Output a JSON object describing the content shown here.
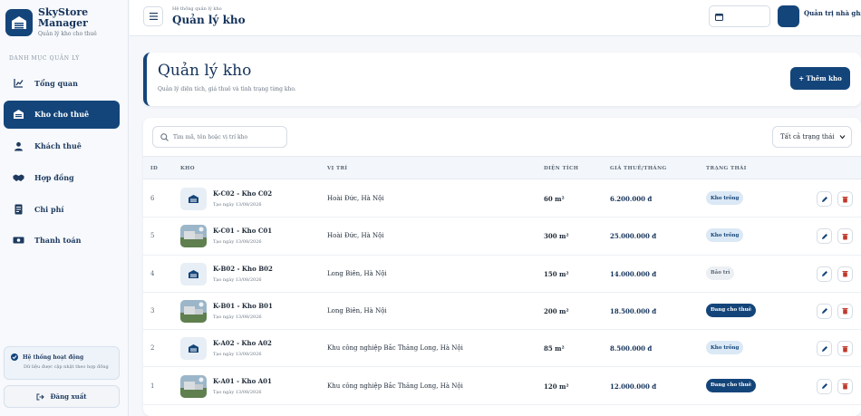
{
  "brand": {
    "name": "SkyStore Manager",
    "subtitle": "Quản lý kho cho thuê"
  },
  "sidebar": {
    "section_label": "DANH MỤC QUẢN LÝ",
    "items": [
      {
        "label": "Tổng quan",
        "icon": "chart-icon"
      },
      {
        "label": "Kho cho thuê",
        "icon": "warehouse-icon",
        "active": true
      },
      {
        "label": "Khách thuê",
        "icon": "user-icon"
      },
      {
        "label": "Hợp đồng",
        "icon": "handshake-icon"
      },
      {
        "label": "Chi phí",
        "icon": "receipt-icon"
      },
      {
        "label": "Thanh toán",
        "icon": "money-icon"
      }
    ],
    "status": {
      "title": "Hệ thống hoạt động",
      "desc": "Dữ liệu được cập nhật theo hợp đồng"
    },
    "logout_label": "Đăng xuất"
  },
  "header": {
    "breadcrumb": "Hệ thống quản lý kho",
    "title": "Quản lý kho",
    "user_name": "Quản trị nhà ghi"
  },
  "page": {
    "title": "Quản lý kho",
    "description": "Quản lý diện tích, giá thuê và tình trạng từng kho.",
    "add_button": "+ Thêm kho"
  },
  "table": {
    "search_placeholder": "Tìm mã, tên hoặc vị trí kho",
    "filter_value": "Tất cả trạng thái",
    "columns": [
      "ID",
      "KHO",
      "VỊ TRÍ",
      "DIỆN TÍCH",
      "GIÁ THUÊ/THÁNG",
      "TRẠNG THÁI"
    ],
    "rows": [
      {
        "id": "6",
        "name": "K-C02 - Kho C02",
        "date": "Tạo ngày 13/08/2026",
        "location": "Hoài Đức, Hà Nội",
        "area": "60 m²",
        "price": "6.200.000 đ",
        "status": "Kho trống",
        "status_type": "empty",
        "thumb": "icon"
      },
      {
        "id": "5",
        "name": "K-C01 - Kho C01",
        "date": "Tạo ngày 13/08/2026",
        "location": "Hoài Đức, Hà Nội",
        "area": "300 m²",
        "price": "25.000.000 đ",
        "status": "Kho trống",
        "status_type": "empty",
        "thumb": "photo"
      },
      {
        "id": "4",
        "name": "K-B02 - Kho B02",
        "date": "Tạo ngày 13/08/2026",
        "location": "Long Biên, Hà Nội",
        "area": "150 m²",
        "price": "14.000.000 đ",
        "status": "Bảo trì",
        "status_type": "maint",
        "thumb": "icon"
      },
      {
        "id": "3",
        "name": "K-B01 - Kho B01",
        "date": "Tạo ngày 13/08/2026",
        "location": "Long Biên, Hà Nội",
        "area": "200 m²",
        "price": "18.500.000 đ",
        "status": "Đang cho thuê",
        "status_type": "rent",
        "thumb": "photo"
      },
      {
        "id": "2",
        "name": "K-A02 - Kho A02",
        "date": "Tạo ngày 13/08/2026",
        "location": "Khu công nghiệp Bắc Thăng Long, Hà Nội",
        "area": "85 m²",
        "price": "8.500.000 đ",
        "status": "Kho trống",
        "status_type": "empty",
        "thumb": "icon"
      },
      {
        "id": "1",
        "name": "K-A01 - Kho A01",
        "date": "Tạo ngày 13/08/2026",
        "location": "Khu công nghiệp Bắc Thăng Long, Hà Nội",
        "area": "120 m²",
        "price": "12.000.000 đ",
        "status": "Đang cho thuê",
        "status_type": "rent",
        "thumb": "photo"
      }
    ]
  },
  "colors": {
    "primary": "#14457a",
    "badge_empty": "#dbe8f5",
    "badge_maint": "#eceff3",
    "delete": "#c0392b"
  }
}
